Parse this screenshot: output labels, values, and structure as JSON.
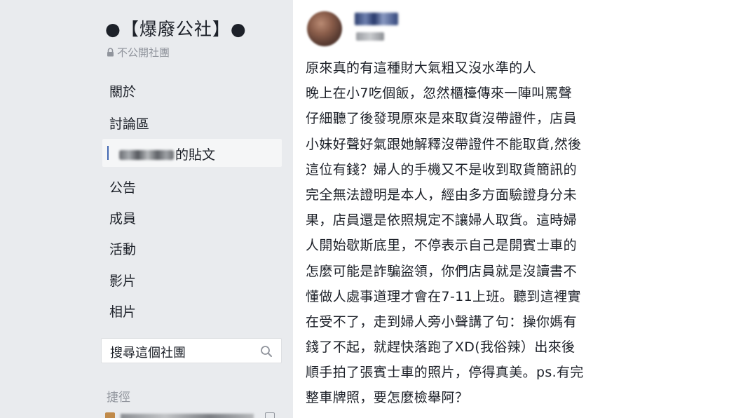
{
  "sidebar": {
    "group_title": "●【爆廢公社】●",
    "privacy_label": "不公開社團",
    "nav_items": [
      {
        "label": "關於"
      },
      {
        "label": "討論區"
      },
      {
        "label": "的貼文"
      },
      {
        "label": "公告"
      },
      {
        "label": "成員"
      },
      {
        "label": "活動"
      },
      {
        "label": "影片"
      },
      {
        "label": "相片"
      }
    ],
    "search_placeholder": "搜尋這個社團",
    "shortcuts_label": "捷徑"
  },
  "post": {
    "lines": [
      "原來真的有這種財大氣粗又沒水準的人",
      "晚上在小7吃個飯，忽然櫃檯傳來一陣叫罵聲",
      "仔細聽了後發現原來是來取貨沒帶證件，店員",
      "小妹好聲好氣跟她解釋沒帶證件不能取貨,然後",
      "這位有錢？婦人的手機又不是收到取貨簡訊的",
      "完全無法證明是本人，經由多方面驗證身分未",
      "果，店員還是依照規定不讓婦人取貨。這時婦",
      "人開始歇斯底里，不停表示自己是開賓士車的",
      "怎麼可能是詐騙盜領，你們店員就是沒讀書不",
      "懂做人處事道理才會在7-11上班。聽到這裡實",
      "在受不了，走到婦人旁小聲講了句：操你媽有",
      "錢了不起，就趕快落跑了XD(我俗辣）出來後",
      "順手拍了張賓士車的照片，停得真美。ps.有完",
      "整車牌照，要怎麼檢舉阿？"
    ]
  },
  "colors": {
    "sidebar_bg": "#e9ebee",
    "text": "#1d2129",
    "muted": "#90949c",
    "active_bar": "#4267b2"
  }
}
